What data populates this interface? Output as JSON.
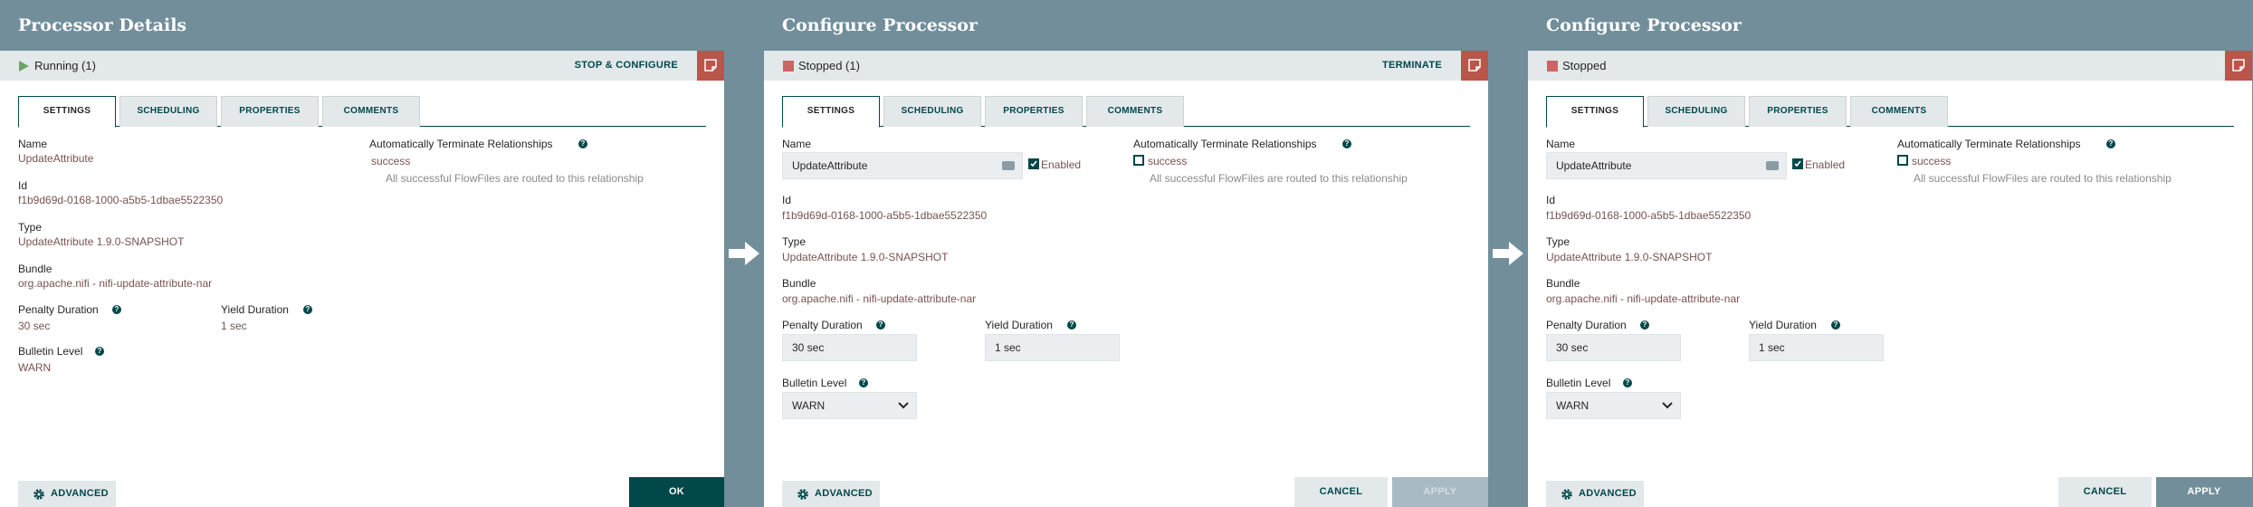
{
  "colors": {
    "header_bg": "#728e9b",
    "accent_dark": "#004849",
    "value_text": "#775351",
    "bulletin_red": "#ba554a",
    "running_green": "#6ca566",
    "stopped_red": "#ce6363"
  },
  "panels": [
    {
      "title": "Processor Details",
      "status_icon": "play-icon",
      "status_text": "Running (1)",
      "status_action": "STOP & CONFIGURE",
      "tabs": [
        "SETTINGS",
        "SCHEDULING",
        "PROPERTIES",
        "COMMENTS"
      ],
      "name_label": "Name",
      "name_value": "UpdateAttribute",
      "id_label": "Id",
      "id_value": "f1b9d69d-0168-1000-a5b5-1dbae5522350",
      "type_label": "Type",
      "type_value": "UpdateAttribute 1.9.0-SNAPSHOT",
      "bundle_label": "Bundle",
      "bundle_value": "org.apache.nifi - nifi-update-attribute-nar",
      "penalty_label": "Penalty Duration",
      "penalty_value": "30 sec",
      "yield_label": "Yield Duration",
      "yield_value": "1 sec",
      "bulletin_label": "Bulletin Level",
      "bulletin_value": "WARN",
      "auto_term_label": "Automatically Terminate Relationships",
      "relationship_name": "success",
      "relationship_desc": "All successful FlowFiles are routed to this relationship",
      "advanced_label": "ADVANCED",
      "ok_label": "OK"
    },
    {
      "title": "Configure Processor",
      "status_icon": "stop-icon",
      "status_text": "Stopped (1)",
      "status_action": "TERMINATE",
      "tabs": [
        "SETTINGS",
        "SCHEDULING",
        "PROPERTIES",
        "COMMENTS"
      ],
      "name_label": "Name",
      "name_value": "UpdateAttribute",
      "enabled_label": "Enabled",
      "enabled_checked": true,
      "id_label": "Id",
      "id_value": "f1b9d69d-0168-1000-a5b5-1dbae5522350",
      "type_label": "Type",
      "type_value": "UpdateAttribute 1.9.0-SNAPSHOT",
      "bundle_label": "Bundle",
      "bundle_value": "org.apache.nifi - nifi-update-attribute-nar",
      "penalty_label": "Penalty Duration",
      "penalty_value": "30 sec",
      "yield_label": "Yield Duration",
      "yield_value": "1 sec",
      "bulletin_label": "Bulletin Level",
      "bulletin_value": "WARN",
      "auto_term_label": "Automatically Terminate Relationships",
      "relationship_name": "success",
      "relationship_checked": false,
      "relationship_desc": "All successful FlowFiles are routed to this relationship",
      "advanced_label": "ADVANCED",
      "cancel_label": "CANCEL",
      "apply_label": "APPLY",
      "apply_enabled": false
    },
    {
      "title": "Configure Processor",
      "status_icon": "stop-icon",
      "status_text": "Stopped",
      "status_action": "",
      "tabs": [
        "SETTINGS",
        "SCHEDULING",
        "PROPERTIES",
        "COMMENTS"
      ],
      "name_label": "Name",
      "name_value": "UpdateAttribute",
      "enabled_label": "Enabled",
      "enabled_checked": true,
      "id_label": "Id",
      "id_value": "f1b9d69d-0168-1000-a5b5-1dbae5522350",
      "type_label": "Type",
      "type_value": "UpdateAttribute 1.9.0-SNAPSHOT",
      "bundle_label": "Bundle",
      "bundle_value": "org.apache.nifi - nifi-update-attribute-nar",
      "penalty_label": "Penalty Duration",
      "penalty_value": "30 sec",
      "yield_label": "Yield Duration",
      "yield_value": "1 sec",
      "bulletin_label": "Bulletin Level",
      "bulletin_value": "WARN",
      "auto_term_label": "Automatically Terminate Relationships",
      "relationship_name": "success",
      "relationship_checked": false,
      "relationship_desc": "All successful FlowFiles are routed to this relationship",
      "advanced_label": "ADVANCED",
      "cancel_label": "CANCEL",
      "apply_label": "APPLY",
      "apply_enabled": true
    }
  ],
  "arrows": [
    "arrow-right-icon",
    "arrow-right-icon"
  ]
}
